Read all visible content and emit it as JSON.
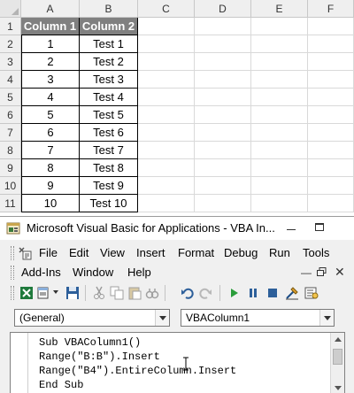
{
  "sheet": {
    "columns": [
      "A",
      "B",
      "C",
      "D",
      "E",
      "F"
    ],
    "rows": [
      "1",
      "2",
      "3",
      "4",
      "5",
      "6",
      "7",
      "8",
      "9",
      "10",
      "11"
    ],
    "header": [
      "Column 1",
      "Column 2"
    ],
    "data": [
      [
        "1",
        "Test 1"
      ],
      [
        "2",
        "Test 2"
      ],
      [
        "3",
        "Test 3"
      ],
      [
        "4",
        "Test 4"
      ],
      [
        "5",
        "Test 5"
      ],
      [
        "6",
        "Test 6"
      ],
      [
        "7",
        "Test 7"
      ],
      [
        "8",
        "Test 8"
      ],
      [
        "9",
        "Test 9"
      ],
      [
        "10",
        "Test 10"
      ]
    ],
    "header_fill": "#808080"
  },
  "vbe": {
    "title": "Microsoft Visual Basic for Applications - VBA In...",
    "menu_row1": [
      "File",
      "Edit",
      "View",
      "Insert",
      "Format",
      "Debug",
      "Run",
      "Tools"
    ],
    "menu_row2": [
      "Add-Ins",
      "Window",
      "Help"
    ],
    "toolbar_icons": [
      "excel-icon",
      "insert-module-icon",
      "save-icon",
      "cut-icon",
      "copy-icon",
      "paste-icon",
      "find-icon",
      "undo-icon",
      "redo-icon",
      "run-icon",
      "break-icon",
      "reset-icon",
      "design-mode-icon",
      "project-explorer-icon"
    ],
    "object_combo": "(General)",
    "procedure_combo": "VBAColumn1",
    "code": [
      "Sub VBAColumn1()",
      "Range(\"B:B\").Insert",
      "Range(\"B4\").EntireColumn.Insert",
      "End Sub"
    ]
  }
}
